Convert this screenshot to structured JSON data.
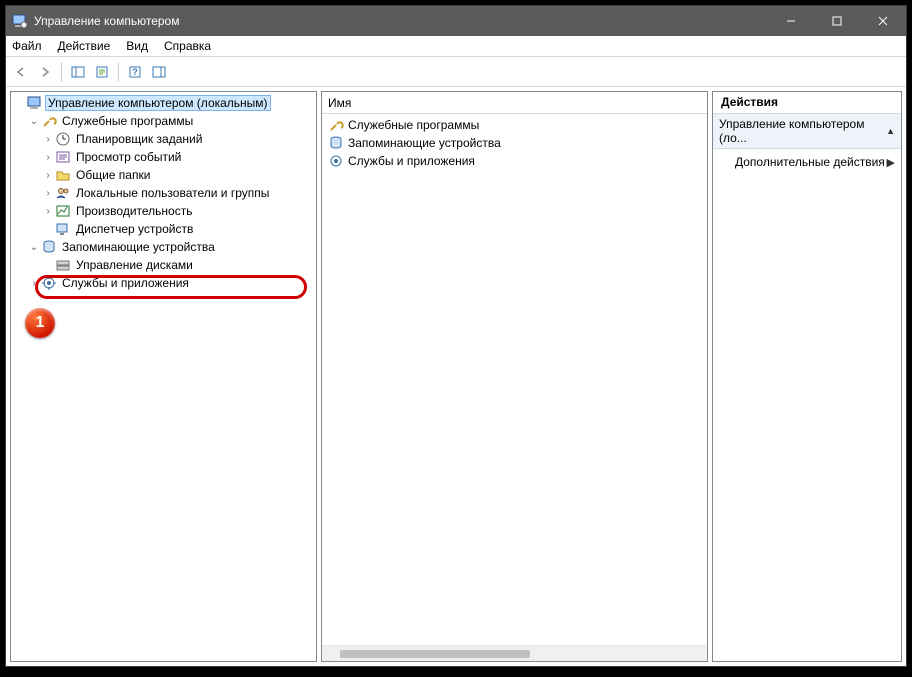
{
  "window": {
    "title": "Управление компьютером"
  },
  "menu": {
    "file": "Файл",
    "action": "Действие",
    "view": "Вид",
    "help": "Справка"
  },
  "tree": {
    "root": "Управление компьютером (локальным)",
    "util": "Служебные программы",
    "scheduler": "Планировщик заданий",
    "event": "Просмотр событий",
    "shared": "Общие папки",
    "users": "Локальные пользователи и группы",
    "perf": "Производительность",
    "devmgr": "Диспетчер устройств",
    "storage": "Запоминающие устройства",
    "diskmgmt": "Управление дисками",
    "services": "Службы и приложения"
  },
  "content": {
    "header_name": "Имя",
    "rows": {
      "util": "Служебные программы",
      "storage": "Запоминающие устройства",
      "services": "Службы и приложения"
    }
  },
  "actions": {
    "header": "Действия",
    "group": "Управление компьютером (ло...",
    "more": "Дополнительные действия"
  },
  "annotation": {
    "badge": "1"
  }
}
